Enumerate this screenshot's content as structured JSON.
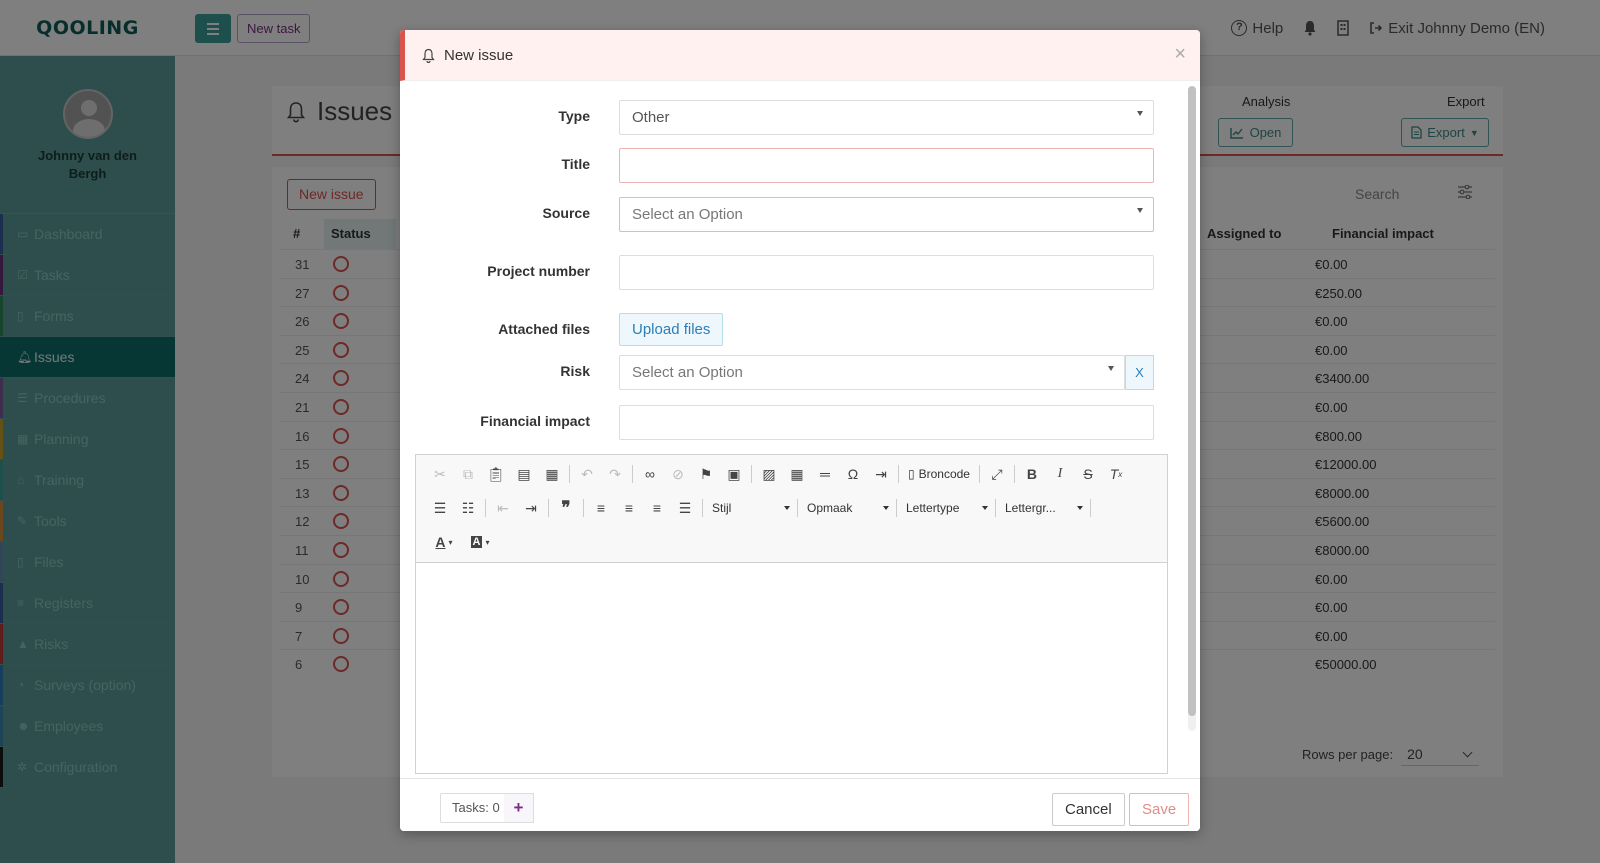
{
  "app": {
    "logo": "QOOLING",
    "new_task": "New task",
    "help": "Help",
    "exit": "Exit Johnny Demo (EN)"
  },
  "sidebar": {
    "user_name": "Johnny van den Bergh",
    "items": [
      {
        "label": "Dashboard",
        "icon": "monitor-icon",
        "color": "#3a5f9e"
      },
      {
        "label": "Tasks",
        "icon": "checkbox-icon",
        "color": "#6c2f7a"
      },
      {
        "label": "Forms",
        "icon": "file-icon",
        "color": "#2e8b57"
      },
      {
        "label": "Issues",
        "icon": "bell-icon",
        "color": "#0e6e69"
      },
      {
        "label": "Procedures",
        "icon": "list-icon",
        "color": "#7a5c9e"
      },
      {
        "label": "Planning",
        "icon": "calendar-icon",
        "color": "#c9a227"
      },
      {
        "label": "Training",
        "icon": "graduation-icon",
        "color": "#3a9e9a"
      },
      {
        "label": "Tools",
        "icon": "wrench-icon",
        "color": "#d98c3a"
      },
      {
        "label": "Files",
        "icon": "file-icon",
        "color": "#5f8fb0"
      },
      {
        "label": "Registers",
        "icon": "bars-icon",
        "color": "#3a5f9e"
      },
      {
        "label": "Risks",
        "icon": "warning-icon",
        "color": "#c03a3a"
      },
      {
        "label": "Surveys (option)",
        "icon": "comment-icon",
        "color": "#2a7fb8"
      },
      {
        "label": "Employees",
        "icon": "users-icon",
        "color": "#3a8ab0"
      },
      {
        "label": "Configuration",
        "icon": "gear-icon",
        "color": "#1a1a1a"
      }
    ]
  },
  "page": {
    "title": "Issues",
    "analysis_label": "Analysis",
    "open_button": "Open",
    "export_label": "Export",
    "export_button": "Export",
    "new_issue_button": "New issue",
    "search_placeholder": "Search",
    "columns": {
      "num": "#",
      "status": "Status",
      "assigned": "Assigned to",
      "financial": "Financial impact"
    },
    "rows": [
      {
        "num": "31",
        "fin": "€0.00"
      },
      {
        "num": "27",
        "fin": "€250.00"
      },
      {
        "num": "26",
        "fin": "€0.00"
      },
      {
        "num": "25",
        "fin": "€0.00"
      },
      {
        "num": "24",
        "fin": "€3400.00"
      },
      {
        "num": "21",
        "fin": "€0.00"
      },
      {
        "num": "16",
        "fin": "€800.00"
      },
      {
        "num": "15",
        "fin": "€12000.00"
      },
      {
        "num": "13",
        "fin": "€8000.00"
      },
      {
        "num": "12",
        "fin": "€5600.00"
      },
      {
        "num": "11",
        "fin": "€8000.00"
      },
      {
        "num": "10",
        "fin": "€0.00"
      },
      {
        "num": "9",
        "fin": "€0.00"
      },
      {
        "num": "7",
        "fin": "€0.00"
      },
      {
        "num": "6",
        "fin": "€50000.00"
      }
    ],
    "rows_per_page_label": "Rows per page:",
    "rows_per_page_value": "20"
  },
  "modal": {
    "title": "New issue",
    "close": "×",
    "fields": {
      "type_label": "Type",
      "type_value": "Other",
      "title_label": "Title",
      "title_value": "",
      "source_label": "Source",
      "source_placeholder": "Select an Option",
      "project_label": "Project number",
      "project_value": "",
      "files_label": "Attached files",
      "upload_button": "Upload files",
      "risk_label": "Risk",
      "risk_placeholder": "Select an Option",
      "risk_clear": "X",
      "financial_label": "Financial impact",
      "financial_value": ""
    },
    "editor": {
      "source_button": "Broncode",
      "style_combo": "Stijl",
      "format_combo": "Opmaak",
      "font_combo": "Lettertype",
      "size_combo": "Lettergr..."
    },
    "footer": {
      "tasks": "Tasks: 0",
      "add_task": "+",
      "cancel": "Cancel",
      "save": "Save"
    }
  }
}
